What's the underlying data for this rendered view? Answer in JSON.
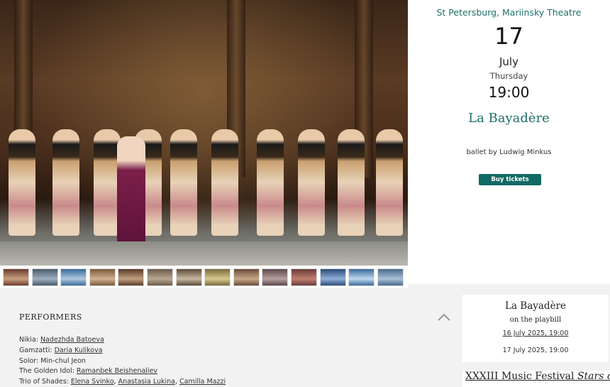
{
  "event": {
    "venue": "St Petersburg, Mariinsky Theatre",
    "day": "17",
    "month": "July",
    "weekday": "Thursday",
    "time": "19:00",
    "title": "La Bayadère",
    "description": "ballet by Ludwig Minkus",
    "buy_label": "Buy tickets",
    "accent_color": "#1e6f68"
  },
  "gallery": {
    "thumbnail_count": 14
  },
  "performers": {
    "heading": "PERFORMERS",
    "collapse_icon": "chevron-up-icon",
    "rows": [
      {
        "role": "Nikia: ",
        "names": [
          "Nadezhda Batoeva"
        ]
      },
      {
        "role": "Gamzatti: ",
        "names": [
          "Daria Kulikova"
        ]
      },
      {
        "role": "Solor: ",
        "plain": "Min-chul Jeon"
      },
      {
        "role": "The Golden Idol: ",
        "names": [
          "Ramanbek Beishenaliev"
        ]
      },
      {
        "role": "Trio of Shades: ",
        "names": [
          "Elena Svinko",
          "Anastasia Lukina",
          "Camilla Mazzi"
        ]
      }
    ]
  },
  "playbill": {
    "title": "La Bayadère",
    "subtitle": "on the playbill",
    "dates": [
      "16 July 2025, 19:00",
      "17 July 2025, 19:00"
    ]
  },
  "festival": {
    "title_prefix": "XXXIII Music Festival ",
    "title_italic": "Stars of"
  }
}
